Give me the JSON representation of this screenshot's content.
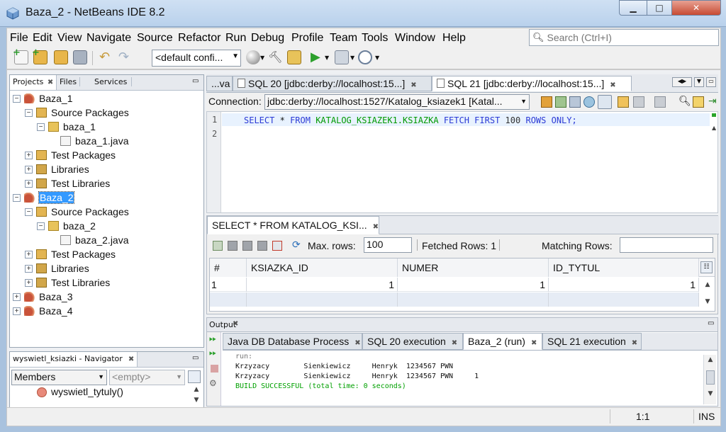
{
  "window": {
    "title": "Baza_2 - NetBeans IDE 8.2",
    "min_icon": "minimize-icon",
    "max_icon": "maximize-icon",
    "close_icon": "close-icon"
  },
  "menu": [
    "File",
    "Edit",
    "View",
    "Navigate",
    "Source",
    "Refactor",
    "Run",
    "Debug",
    "Profile",
    "Team",
    "Tools",
    "Window",
    "Help"
  ],
  "search": {
    "placeholder": "Search (Ctrl+I)"
  },
  "toolbar": {
    "config": "<default confi..."
  },
  "left_panel": {
    "tabs": [
      "Projects",
      "Files",
      "Services"
    ],
    "tree": [
      {
        "label": "Baza_1",
        "type": "project"
      },
      {
        "label": "Source Packages",
        "type": "src"
      },
      {
        "label": "baza_1",
        "type": "package"
      },
      {
        "label": "baza_1.java",
        "type": "class"
      },
      {
        "label": "Test Packages",
        "type": "src"
      },
      {
        "label": "Libraries",
        "type": "lib"
      },
      {
        "label": "Test Libraries",
        "type": "lib"
      },
      {
        "label": "Baza_2",
        "type": "project"
      },
      {
        "label": "Source Packages",
        "type": "src"
      },
      {
        "label": "baza_2",
        "type": "package"
      },
      {
        "label": "baza_2.java",
        "type": "class"
      },
      {
        "label": "Test Packages",
        "type": "src"
      },
      {
        "label": "Libraries",
        "type": "lib"
      },
      {
        "label": "Test Libraries",
        "type": "lib"
      },
      {
        "label": "Baza_3",
        "type": "project"
      },
      {
        "label": "Baza_4",
        "type": "project"
      }
    ]
  },
  "navigator": {
    "title": "wyswietl_ksiazki - Navigator",
    "members": "Members",
    "empty": "<empty>",
    "item": "wyswietl_tytuly()"
  },
  "editor": {
    "tabs": [
      "...va",
      "SQL 20 [jdbc:derby://localhost:15...]",
      "SQL 21 [jdbc:derby://localhost:15...]"
    ],
    "connection_label": "Connection:",
    "connection_value": "jdbc:derby://localhost:1527/Katalog_ksiazek1 [Katal...",
    "lines": [
      "1",
      "2"
    ],
    "sql": {
      "kw1": "SELECT",
      "star": "*",
      "kw2": "FROM",
      "table": "KATALOG_KSIAZEK1.KSIAZKA",
      "kw3": "FETCH FIRST",
      "num": "100",
      "kw4": "ROWS ONLY;"
    }
  },
  "results": {
    "tab": "SELECT * FROM KATALOG_KSI...",
    "max_rows_label": "Max. rows:",
    "max_rows_value": "100",
    "fetched_rows": "Fetched Rows: 1",
    "matching_rows_label": "Matching Rows:",
    "columns": [
      "#",
      "KSIAZKA_ID",
      "NUMER",
      "ID_TYTUL"
    ],
    "rows": [
      [
        "1",
        "1",
        "1",
        "1"
      ]
    ]
  },
  "output": {
    "title": "Output",
    "tabs": [
      "Java DB Database Process",
      "SQL 20 execution",
      "Baza_2 (run)",
      "SQL 21 execution"
    ],
    "lines": [
      "run:",
      "Krzyzacy        Sienkiewicz     Henryk  1234567 PWN",
      "Krzyzacy        Sienkiewicz     Henryk  1234567 PWN     1",
      "BUILD SUCCESSFUL (total time: 0 seconds)"
    ]
  },
  "status": {
    "position": "1:1",
    "mode": "INS"
  },
  "colors": {
    "keyword": "#2b3ad6",
    "table": "#009a00",
    "success": "#00a000"
  }
}
